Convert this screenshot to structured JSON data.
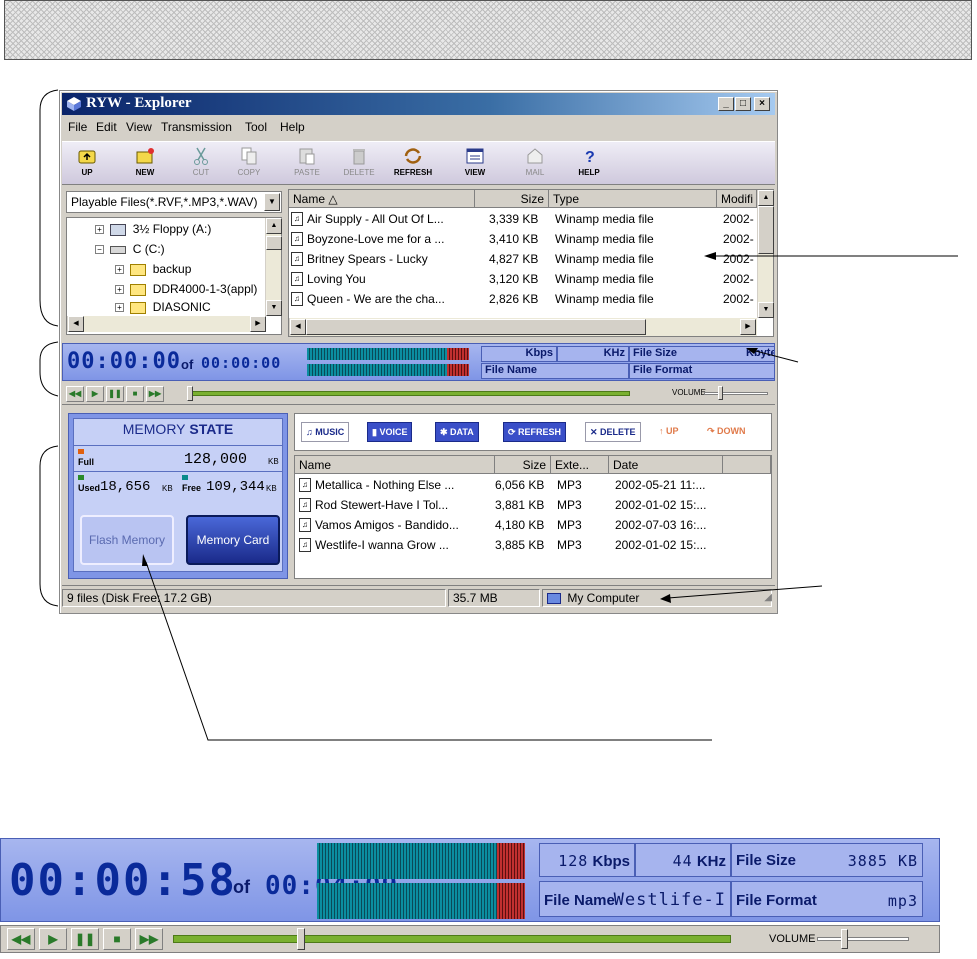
{
  "window": {
    "title": "RYW - Explorer",
    "controls": [
      "_",
      "□",
      "×"
    ]
  },
  "menu": [
    "File",
    "Edit",
    "View",
    "Transmission",
    "Tool",
    "Help"
  ],
  "toolbar": [
    {
      "label": "UP",
      "icon": "up-folder-icon",
      "enabled": true
    },
    {
      "label": "NEW",
      "icon": "new-folder-icon",
      "enabled": true
    },
    {
      "label": "CUT",
      "icon": "scissors-icon",
      "enabled": false
    },
    {
      "label": "COPY",
      "icon": "copy-icon",
      "enabled": false
    },
    {
      "label": "PASTE",
      "icon": "paste-icon",
      "enabled": false
    },
    {
      "label": "DELETE",
      "icon": "trash-icon",
      "enabled": false
    },
    {
      "label": "REFRESH",
      "icon": "refresh-icon",
      "enabled": true
    },
    {
      "label": "VIEW",
      "icon": "view-icon",
      "enabled": true
    },
    {
      "label": "MAIL",
      "icon": "mail-icon",
      "enabled": false
    },
    {
      "label": "HELP",
      "icon": "help-icon",
      "enabled": true
    }
  ],
  "filter": "Playable Files(*.RVF,*.MP3,*.WAV)",
  "tree": [
    {
      "label": "3½ Floppy (A:)",
      "icon": "floppy-icon"
    },
    {
      "label": "C (C:)",
      "icon": "drive-icon"
    },
    {
      "label": "backup",
      "icon": "folder-icon"
    },
    {
      "label": "DDR4000-1-3(appl)",
      "icon": "folder-icon"
    },
    {
      "label": "DIASONIC",
      "icon": "folder-icon"
    }
  ],
  "filelist": {
    "headers": [
      "Name",
      "Size",
      "Type",
      "Modifi"
    ],
    "rows": [
      {
        "name": "Air Supply - All Out Of L...",
        "size": "3,339 KB",
        "type": "Winamp media file",
        "mod": "2002-"
      },
      {
        "name": "Boyzone-Love me for a ...",
        "size": "3,410 KB",
        "type": "Winamp media file",
        "mod": "2002-"
      },
      {
        "name": "Britney Spears - Lucky",
        "size": "4,827 KB",
        "type": "Winamp media file",
        "mod": "2002-"
      },
      {
        "name": "Loving You",
        "size": "3,120 KB",
        "type": "Winamp media file",
        "mod": "2002-"
      },
      {
        "name": "Queen - We are the cha...",
        "size": "2,826 KB",
        "type": "Winamp media file",
        "mod": "2002-"
      }
    ]
  },
  "player": {
    "time": "00:00:00",
    "of": "of",
    "total": "00:00:00",
    "kbps_label": "Kbps",
    "khz_label": "KHz",
    "filesize_label": "File Size",
    "kbyte_label": "Kbyte",
    "filename_label": "File Name",
    "fileformat_label": "File Format",
    "volume_label": "VOLUME",
    "seek_fraction": 0.0
  },
  "memory": {
    "title_a": "MEMORY",
    "title_b": "STATE",
    "full_label": "Full",
    "full_value": "128,000",
    "used_label": "Used",
    "used_value": "18,656",
    "free_label": "Free",
    "free_value": "109,344",
    "unit": "KB",
    "flash_button": "Flash Memory",
    "card_button": "Memory Card"
  },
  "device_toolbar": [
    {
      "label": "MUSIC",
      "style": "white"
    },
    {
      "label": "VOICE",
      "style": "blue"
    },
    {
      "label": "DATA",
      "style": "blue"
    },
    {
      "label": "REFRESH",
      "style": "blue"
    },
    {
      "label": "DELETE",
      "style": "white"
    },
    {
      "label": "UP",
      "style": "dis"
    },
    {
      "label": "DOWN",
      "style": "dis"
    }
  ],
  "devlist": {
    "headers": [
      "Name",
      "Size",
      "Exte...",
      "Date"
    ],
    "rows": [
      {
        "name": "Metallica - Nothing Else ...",
        "size": "6,056 KB",
        "ext": "MP3",
        "date": "2002-05-21 11:..."
      },
      {
        "name": "Rod Stewert-Have I Tol...",
        "size": "3,881 KB",
        "ext": "MP3",
        "date": "2002-01-02 15:..."
      },
      {
        "name": "Vamos Amigos - Bandido...",
        "size": "4,180 KB",
        "ext": "MP3",
        "date": "2002-07-03 16:..."
      },
      {
        "name": "Westlife-I wanna Grow ...",
        "size": "3,885 KB",
        "ext": "MP3",
        "date": "2002-01-02 15:..."
      }
    ]
  },
  "status": {
    "files": "9 files (Disk Free: 17.2 GB)",
    "size": "35.7 MB",
    "location": "My Computer"
  },
  "big_player": {
    "time": "00:00:58",
    "of": "of",
    "total": "00:04:09",
    "kbps_value": "128",
    "kbps_label": "Kbps",
    "khz_value": "44",
    "khz_label": "KHz",
    "filesize_label": "File Size",
    "filesize_value": "3885",
    "filesize_unit": "KB",
    "filename_label": "File Name",
    "filename_value": "Westlife-I",
    "fileformat_label": "File Format",
    "fileformat_value": "mp3",
    "volume_label": "VOLUME",
    "seek_fraction": 0.23
  },
  "colors": {
    "title_gradient_start": "#0a246a",
    "player_blue": "#7f95e6",
    "lcd_text": "#0a2a9a",
    "seek_green": "#7ab030"
  }
}
